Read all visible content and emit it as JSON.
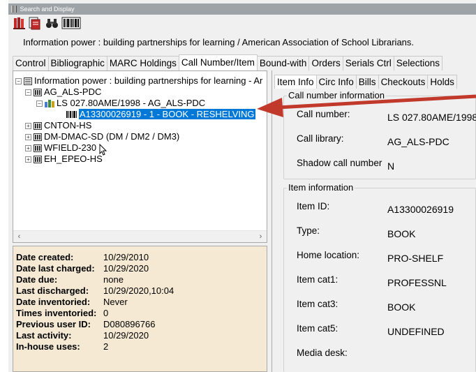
{
  "window": {
    "title": "Search and Display"
  },
  "toolbar": {
    "buttons": [
      "books-icon",
      "holdings-icon",
      "binoculars-icon",
      "barcode-icon"
    ]
  },
  "record": {
    "title": "Information power : building partnerships for learning / American Association of School Librarians."
  },
  "tabs": [
    {
      "label": "Control"
    },
    {
      "label": "Bibliographic"
    },
    {
      "label": "MARC Holdings"
    },
    {
      "label": "Call Number/Item"
    },
    {
      "label": "Bound-with"
    },
    {
      "label": "Orders"
    },
    {
      "label": "Serials Ctrl"
    },
    {
      "label": "Selections"
    }
  ],
  "active_tab": "Call Number/Item",
  "tree": {
    "root": "Information power : building partnerships for learning - Ar",
    "ag_library": "AG_ALS-PDC",
    "callnum": "LS 027.80AME/1998 - AG_ALS-PDC",
    "item": "A13300026919 - 1 - BOOK - RESHELVING",
    "libraries": [
      "CNTON-HS",
      "DM-DMAC-SD (DM / DM2 / DM3)",
      "WFIELD-230",
      "EH_EPEO-HS"
    ]
  },
  "details": [
    {
      "label": "Date created:",
      "value": "10/29/2010"
    },
    {
      "label": "Date last charged:",
      "value": "10/29/2020"
    },
    {
      "label": "Date due:",
      "value": "none"
    },
    {
      "label": "Last discharged:",
      "value": "10/29/2020,10:04"
    },
    {
      "label": "Date inventoried:",
      "value": "Never"
    },
    {
      "label": "Times inventoried:",
      "value": "0"
    },
    {
      "label": "Previous user ID:",
      "value": "D080896766"
    },
    {
      "label": "Last activity:",
      "value": "10/29/2020"
    },
    {
      "label": "In-house uses:",
      "value": "2"
    }
  ],
  "right_tabs": [
    {
      "label": "Item Info"
    },
    {
      "label": "Circ Info"
    },
    {
      "label": "Bills"
    },
    {
      "label": "Checkouts"
    },
    {
      "label": "Holds"
    }
  ],
  "callnum_group": {
    "legend": "Call number information",
    "fields": [
      {
        "label": "Call number:",
        "value": "LS 027.80AME/1998"
      },
      {
        "label": "Call library:",
        "value": "AG_ALS-PDC"
      },
      {
        "label": "Shadow call number",
        "value": "N"
      }
    ]
  },
  "item_group": {
    "legend": "Item information",
    "fields": [
      {
        "label": "Item ID:",
        "value": "A13300026919"
      },
      {
        "label": "Type:",
        "value": "BOOK"
      },
      {
        "label": "Home location:",
        "value": "PRO-SHELF"
      },
      {
        "label": "Item cat1:",
        "value": "PROFESSNL"
      },
      {
        "label": "Item cat3:",
        "value": "BOOK"
      },
      {
        "label": "Item cat5:",
        "value": "UNDEFINED"
      },
      {
        "label": "Media desk:",
        "value": ""
      }
    ]
  },
  "colors": {
    "selection": "#0078d7",
    "detail_bg": "#f5e9d3",
    "arrow": "#c0392b"
  }
}
